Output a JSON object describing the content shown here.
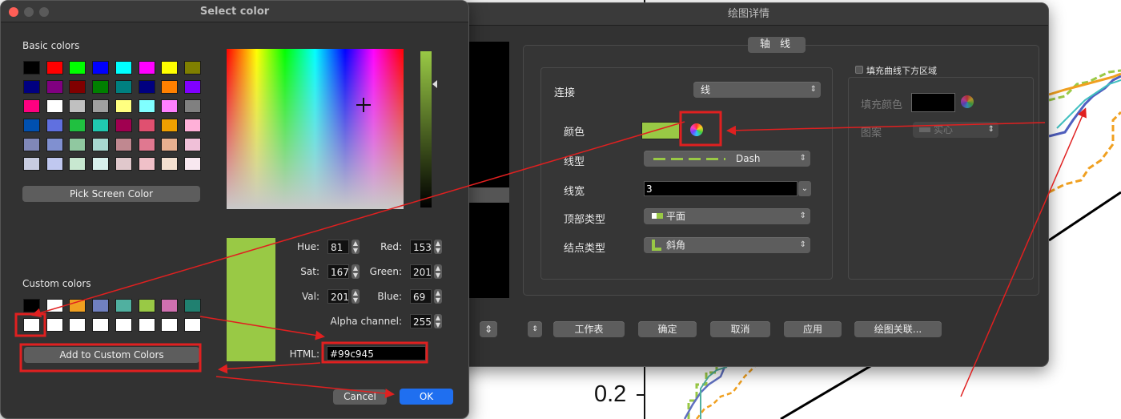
{
  "colors": {
    "dialog_bg": "#323232",
    "selected_color": "#99c945",
    "accent_blue": "#1f6ff0",
    "annotation_red": "#e02020"
  },
  "background_plot": {
    "tick_label": "0.2"
  },
  "plot_details_window": {
    "title": "绘图详情",
    "tab_label": "轴  线",
    "line_group": {
      "connect_label": "连接",
      "connect_value": "线",
      "color_label": "颜色",
      "color_value": "#99c945",
      "color_wheel_icon": "color-wheel-icon",
      "linestyle_label": "线型",
      "linestyle_value": "Dash",
      "linewidth_label": "线宽",
      "linewidth_value": "3",
      "cap_label": "顶部类型",
      "cap_value": "平面",
      "join_label": "结点类型",
      "join_value": "斜角"
    },
    "fill_group": {
      "checkbox_label": "填充曲线下方区域",
      "fill_color_label": "填充颜色",
      "pattern_label": "图案",
      "pattern_value": "实心"
    },
    "buttons": {
      "worksheet": "工作表",
      "ok": "确定",
      "cancel": "取消",
      "apply": "应用",
      "plot_associate": "绘图关联..."
    }
  },
  "color_dialog": {
    "title": "Select color",
    "basic_colors_label": "Basic colors",
    "basic_colors": [
      "#000000",
      "#ff0000",
      "#00ff00",
      "#0000ff",
      "#00ffff",
      "#ff00ff",
      "#ffff00",
      "#808000",
      "#000080",
      "#800080",
      "#800000",
      "#008000",
      "#008080",
      "#000080",
      "#ff8000",
      "#8000ff",
      "#ff0080",
      "#ffffff",
      "#c0c0c0",
      "#a0a0a0",
      "#ffff80",
      "#80ffff",
      "#ff80ff",
      "#808080",
      "#0050b0",
      "#6070e0",
      "#20c040",
      "#20c8b0",
      "#a00050",
      "#e05070",
      "#f0a000",
      "#ffb0d8",
      "#8088b8",
      "#8090d0",
      "#90c8a0",
      "#a8d8d0",
      "#c08890",
      "#e07890",
      "#e8b090",
      "#f0c0d8",
      "#c8cce0",
      "#c0c8f0",
      "#c8e8d0",
      "#d8f0ec",
      "#e0c8cc",
      "#f0c0c8",
      "#f4e0d0",
      "#f8e8f0"
    ],
    "pick_screen_color": "Pick Screen Color",
    "custom_colors_label": "Custom colors",
    "custom_colors": [
      "#000000",
      "#ffffff",
      "#f0a020",
      "#7080c0",
      "#50b0a0",
      "#99c945",
      "#d070b0",
      "#208070",
      "#ffffff",
      "#ffffff",
      "#ffffff",
      "#ffffff",
      "#ffffff",
      "#ffffff",
      "#ffffff",
      "#ffffff"
    ],
    "add_to_custom": "Add to Custom Colors",
    "fields": {
      "hue_label": "Hue:",
      "hue": "81",
      "sat_label": "Sat:",
      "sat": "167",
      "val_label": "Val:",
      "val": "201",
      "red_label": "Red:",
      "red": "153",
      "green_label": "Green:",
      "green": "201",
      "blue_label": "Blue:",
      "blue": "69",
      "alpha_label": "Alpha channel:",
      "alpha": "255",
      "html_label": "HTML:",
      "html": "#99c945"
    },
    "cancel": "Cancel",
    "ok": "OK"
  }
}
